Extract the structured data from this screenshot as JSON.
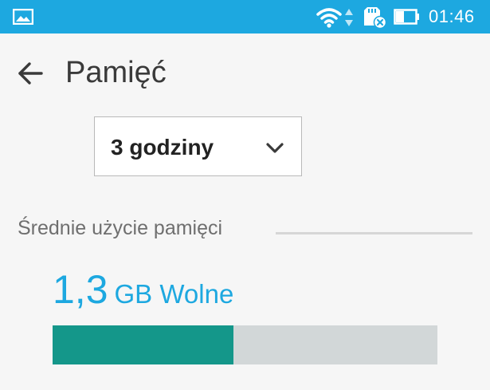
{
  "status_bar": {
    "time": "01:46",
    "icons": [
      "gallery-icon",
      "wifi-icon",
      "data-arrows-icon",
      "sd-card-icon",
      "battery-icon"
    ],
    "background": "#1da8e0"
  },
  "toolbar": {
    "back_icon": "arrow-left-icon",
    "title": "Pamięć"
  },
  "period_dropdown": {
    "selected": "3 godziny",
    "icon": "chevron-down-icon"
  },
  "average_usage": {
    "header": "Średnie użycie pamięci",
    "free_amount": "1,3",
    "free_unit": "GB Wolne",
    "used_fraction": 0.47,
    "used_color": "#14978a",
    "free_color": "#d2d7d8",
    "accent": "#1da8e0"
  }
}
